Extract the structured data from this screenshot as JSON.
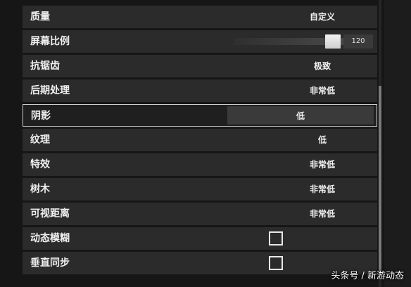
{
  "settings": [
    {
      "label": "质量",
      "type": "value",
      "value": "自定义"
    },
    {
      "label": "屏幕比例",
      "type": "slider",
      "value": "120",
      "fill": 0.86
    },
    {
      "label": "抗锯齿",
      "type": "value",
      "value": "极致"
    },
    {
      "label": "后期处理",
      "type": "value",
      "value": "非常低"
    },
    {
      "label": "阴影",
      "type": "value",
      "value": "低",
      "active": true
    },
    {
      "label": "纹理",
      "type": "value",
      "value": "低"
    },
    {
      "label": "特效",
      "type": "value",
      "value": "非常低"
    },
    {
      "label": "树木",
      "type": "value",
      "value": "非常低"
    },
    {
      "label": "可视距离",
      "type": "value",
      "value": "非常低"
    },
    {
      "label": "动态模糊",
      "type": "checkbox",
      "checked": false
    },
    {
      "label": "垂直同步",
      "type": "checkbox",
      "checked": false
    }
  ],
  "watermark": "头条号 / 新游动态"
}
